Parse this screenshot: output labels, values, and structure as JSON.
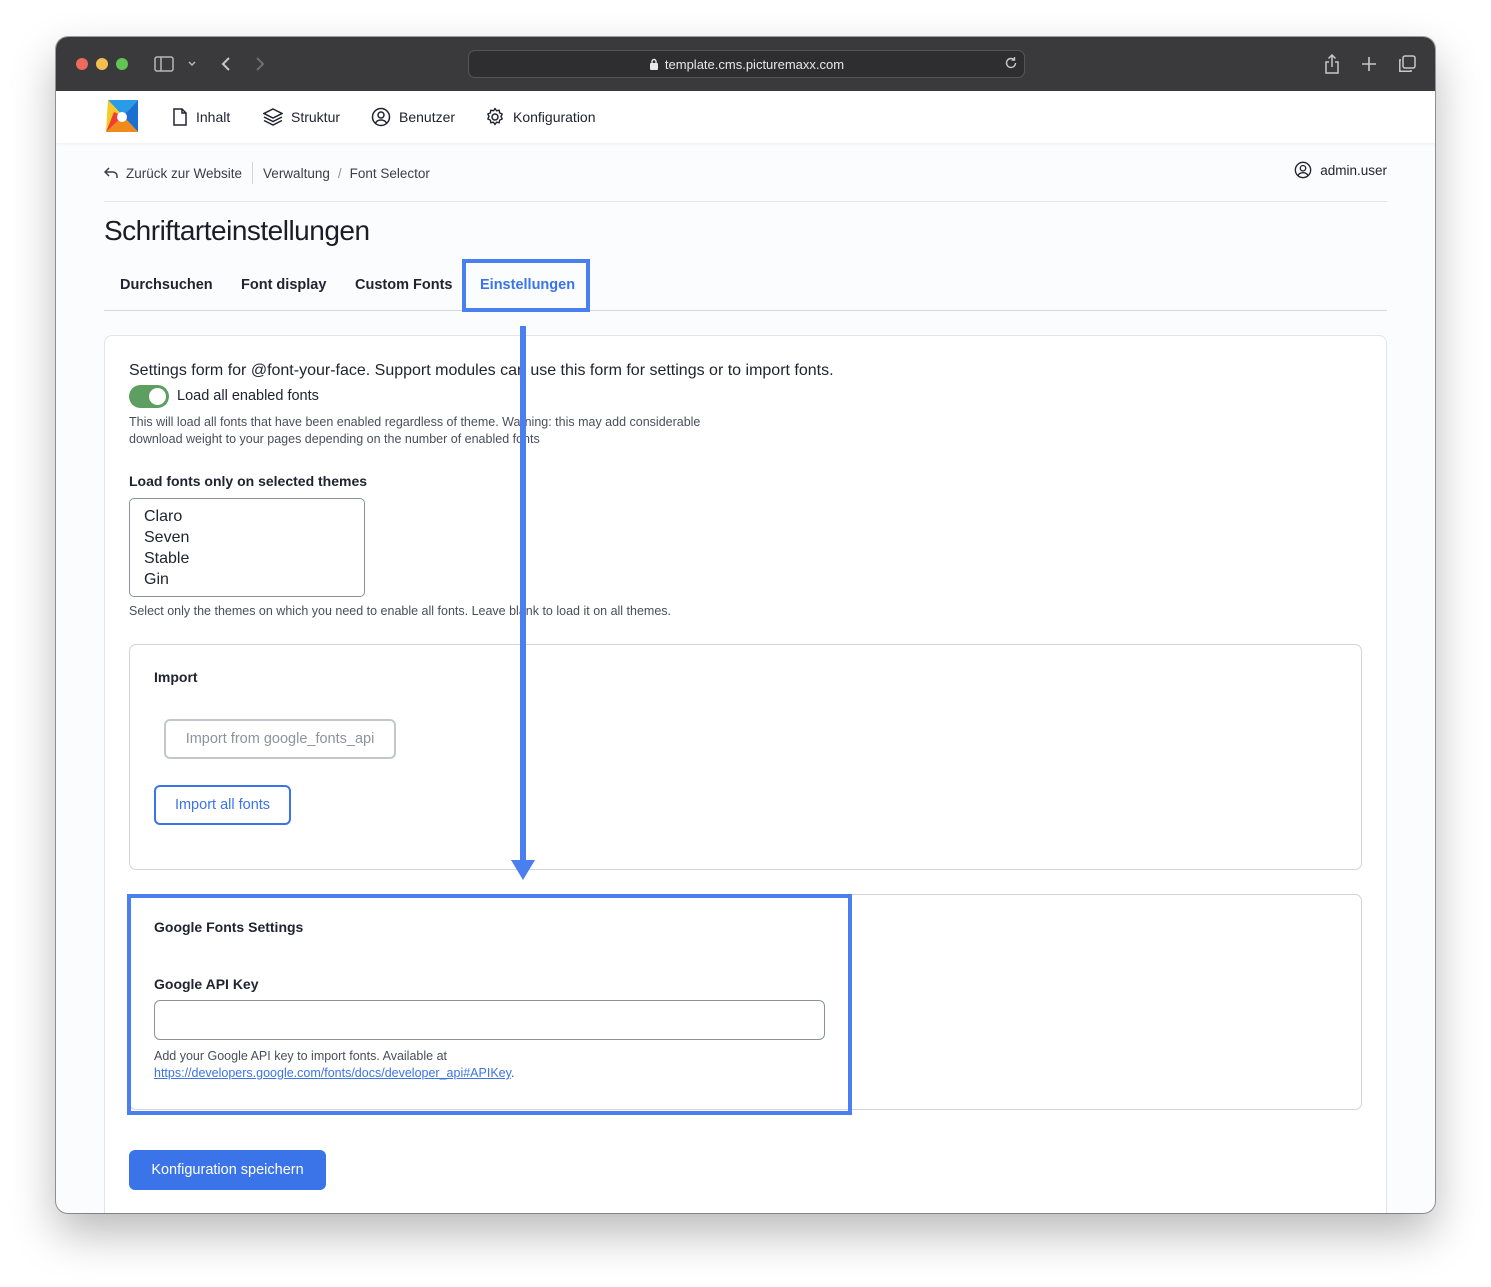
{
  "browser": {
    "url": "template.cms.picturemaxx.com",
    "traffic_lights": [
      "#ed6a5e",
      "#f5bf4f",
      "#61c554"
    ]
  },
  "toolbar": {
    "items": [
      {
        "label": "Inhalt",
        "icon": "file-icon"
      },
      {
        "label": "Struktur",
        "icon": "layers-icon"
      },
      {
        "label": "Benutzer",
        "icon": "user-circle-icon"
      },
      {
        "label": "Konfiguration",
        "icon": "gear-icon"
      }
    ]
  },
  "breadcrumb": {
    "back_label": "Zurück zur Website",
    "items": [
      "Verwaltung",
      "Font Selector"
    ]
  },
  "user": {
    "name": "admin.user"
  },
  "page": {
    "title": "Schriftarteinstellungen"
  },
  "tabs": [
    {
      "label": "Durchsuchen",
      "active": false
    },
    {
      "label": "Font display",
      "active": false
    },
    {
      "label": "Custom Fonts",
      "active": false
    },
    {
      "label": "Einstellungen",
      "active": true
    }
  ],
  "form": {
    "intro": "Settings form for @font-your-face. Support modules can use this form for settings or to import fonts.",
    "load_all": {
      "label": "Load all enabled fonts",
      "checked": true,
      "desc_line1": "This will load all fonts that have been enabled regardless of theme. Warning: this may add considerable",
      "desc_line2": "download weight to your pages depending on the number of enabled fonts"
    },
    "themes": {
      "label": "Load fonts only on selected themes",
      "options": [
        "Claro",
        "Seven",
        "Stable",
        "Gin"
      ],
      "desc": "Select only the themes on which you need to enable all fonts. Leave blank to load it on all themes."
    },
    "import": {
      "legend": "Import",
      "google_button": "Import from google_fonts_api",
      "all_button": "Import all fonts"
    },
    "google": {
      "legend": "Google Fonts Settings",
      "api_label": "Google API Key",
      "api_value": "",
      "help_text": "Add your Google API key to import fonts. Available at",
      "help_link": "https://developers.google.com/fonts/docs/developer_api#APIKey",
      "help_suffix": "."
    },
    "save_button": "Konfiguration speichern"
  },
  "colors": {
    "accent": "#3b74e8",
    "highlight": "#4a7ff0",
    "toggle_on": "#5d9e61"
  }
}
